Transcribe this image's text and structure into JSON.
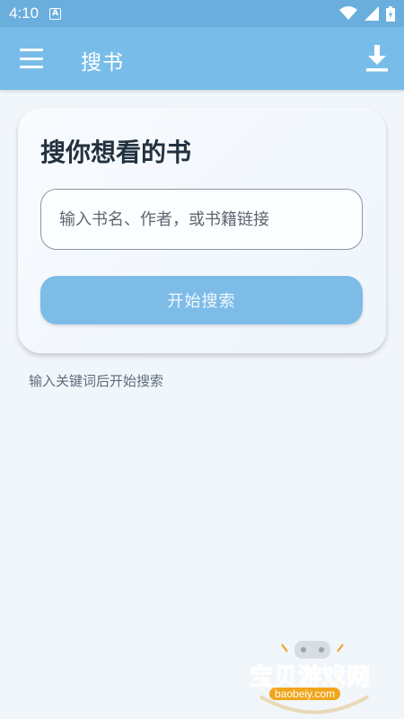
{
  "status_bar": {
    "time": "4:10",
    "notification_icon": "a-box-icon",
    "icons": [
      "wifi-icon",
      "signal-icon",
      "battery-icon"
    ]
  },
  "app_bar": {
    "menu_icon": "hamburger-menu-icon",
    "title": "搜书",
    "download_icon": "download-icon"
  },
  "search_card": {
    "title": "搜你想看的书",
    "input_placeholder": "输入书名、作者，或书籍链接",
    "input_value": "",
    "button_label": "开始搜索"
  },
  "hint": "输入关键词后开始搜索",
  "watermark": {
    "text": "宝贝游戏网",
    "url": "baobeiy.com"
  },
  "colors": {
    "status_bar": "#6aaede",
    "app_bar": "#78bdea",
    "button": "#7ebce8",
    "background": "#f1f6fb"
  }
}
